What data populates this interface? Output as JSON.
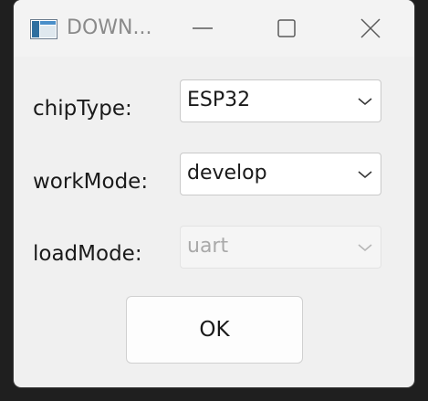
{
  "window": {
    "title": "DOWN..."
  },
  "form": {
    "chip_type": {
      "label": "chipType:",
      "value": "ESP32"
    },
    "work_mode": {
      "label": "workMode:",
      "value": "develop"
    },
    "load_mode": {
      "label": "loadMode:",
      "value": "uart",
      "disabled": true
    }
  },
  "buttons": {
    "ok_label": "OK"
  },
  "icons": {
    "app": "app-window-icon",
    "minimize": "minimize-icon",
    "maximize": "maximize-icon",
    "close": "close-icon",
    "dropdown": "chevron-down-icon"
  }
}
